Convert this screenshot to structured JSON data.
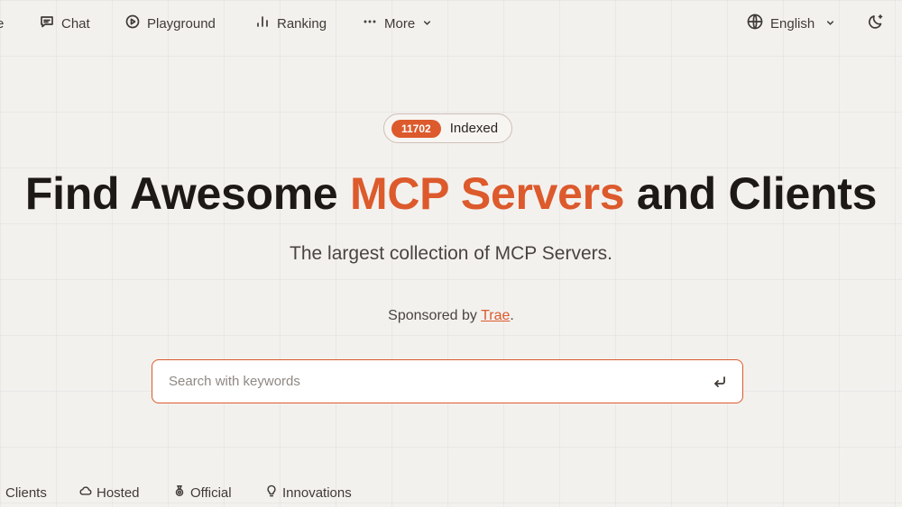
{
  "nav": {
    "cut_item": "e",
    "chat": "Chat",
    "playground": "Playground",
    "ranking": "Ranking",
    "more": "More",
    "language": "English"
  },
  "badge": {
    "count": "11702",
    "label": "Indexed"
  },
  "hero": {
    "title_pre": "Find Awesome ",
    "title_accent": "MCP Servers",
    "title_post": " and Clients",
    "subtitle": "The largest collection of MCP Servers."
  },
  "sponsor": {
    "prefix": "Sponsored by ",
    "link": "Trae",
    "suffix": "."
  },
  "search": {
    "placeholder": "Search with keywords",
    "value": ""
  },
  "tabs": {
    "clients": "Clients",
    "hosted": "Hosted",
    "official": "Official",
    "innovations": "Innovations"
  },
  "colors": {
    "accent": "#dc5a2c",
    "background": "#f3f1ee",
    "text": "#1c1917"
  }
}
